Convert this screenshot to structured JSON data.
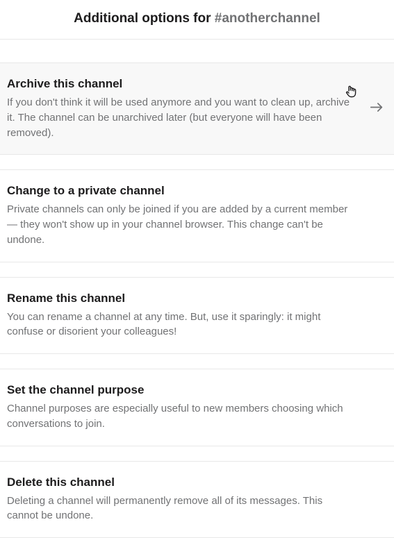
{
  "header": {
    "title_prefix": "Additional options for ",
    "channel": "#anotherchannel"
  },
  "options": {
    "archive": {
      "title": "Archive this channel",
      "desc": "If you don't think it will be used anymore and you want to clean up, archive it. The channel can be unarchived later (but everyone will have been removed)."
    },
    "private": {
      "title": "Change to a private channel",
      "desc": "Private channels can only be joined if you are added by a current member — they won't show up in your channel browser. This change can't be undone."
    },
    "rename": {
      "title": "Rename this channel",
      "desc": "You can rename a channel at any time. But, use it sparingly: it might confuse or disorient your colleagues!"
    },
    "purpose": {
      "title": "Set the channel purpose",
      "desc": "Channel purposes are especially useful to new members choosing which conversations to join."
    },
    "delete": {
      "title": "Delete this channel",
      "desc": "Deleting a channel will permanently remove all of its messages. This cannot be undone."
    }
  }
}
